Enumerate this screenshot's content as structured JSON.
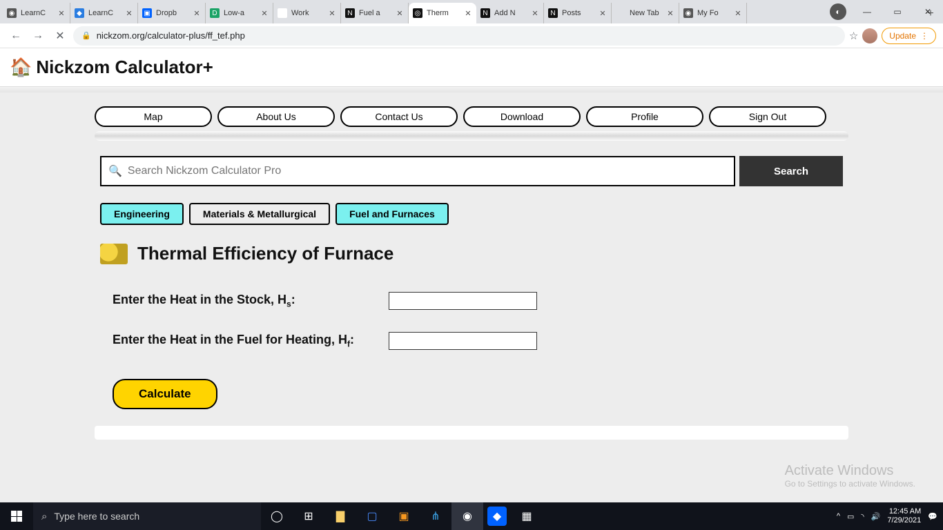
{
  "browser": {
    "tabs": [
      {
        "title": "LearnC",
        "favicon_bg": "#555",
        "favicon_char": "◉"
      },
      {
        "title": "LearnC",
        "favicon_bg": "#2a7de1",
        "favicon_char": "◆"
      },
      {
        "title": "Dropb",
        "favicon_bg": "#0062ff",
        "favicon_char": "▣"
      },
      {
        "title": "Low-a",
        "favicon_bg": "#1aa366",
        "favicon_char": "D"
      },
      {
        "title": "Work",
        "favicon_bg": "#fff",
        "favicon_char": "M"
      },
      {
        "title": "Fuel a",
        "favicon_bg": "#111",
        "favicon_char": "N"
      },
      {
        "title": "Therm",
        "favicon_bg": "#111",
        "favicon_char": "◎"
      },
      {
        "title": "Add N",
        "favicon_bg": "#111",
        "favicon_char": "N"
      },
      {
        "title": "Posts",
        "favicon_bg": "#111",
        "favicon_char": "N"
      },
      {
        "title": "New Tab",
        "favicon_bg": "transparent",
        "favicon_char": ""
      },
      {
        "title": "My Fo",
        "favicon_bg": "#555",
        "favicon_char": "◉"
      }
    ],
    "active_tab_index": 6,
    "url": "nickzom.org/calculator-plus/ff_tef.php",
    "update_label": "Update"
  },
  "site": {
    "brand": "Nickzom Calculator+",
    "nav": [
      "Map",
      "About Us",
      "Contact Us",
      "Download",
      "Profile",
      "Sign Out"
    ],
    "search_placeholder": "Search Nickzom Calculator Pro",
    "search_button": "Search",
    "breadcrumbs": [
      {
        "label": "Engineering",
        "active": true
      },
      {
        "label": "Materials & Metallurgical",
        "active": false
      },
      {
        "label": "Fuel and Furnaces",
        "active": false
      }
    ],
    "page_title": "Thermal Efficiency of Furnace",
    "form": {
      "hs_label_pre": "Enter the Heat in the Stock, H",
      "hs_sub": "s",
      "hs_colon": ":",
      "hf_label_pre": "Enter the Heat in the Fuel for Heating, H",
      "hf_sub": "f",
      "hf_colon": ":",
      "calculate": "Calculate"
    }
  },
  "watermark": {
    "line1": "Activate Windows",
    "line2": "Go to Settings to activate Windows."
  },
  "taskbar": {
    "search_placeholder": "Type here to search",
    "time": "12:45 AM",
    "date": "7/29/2021"
  }
}
